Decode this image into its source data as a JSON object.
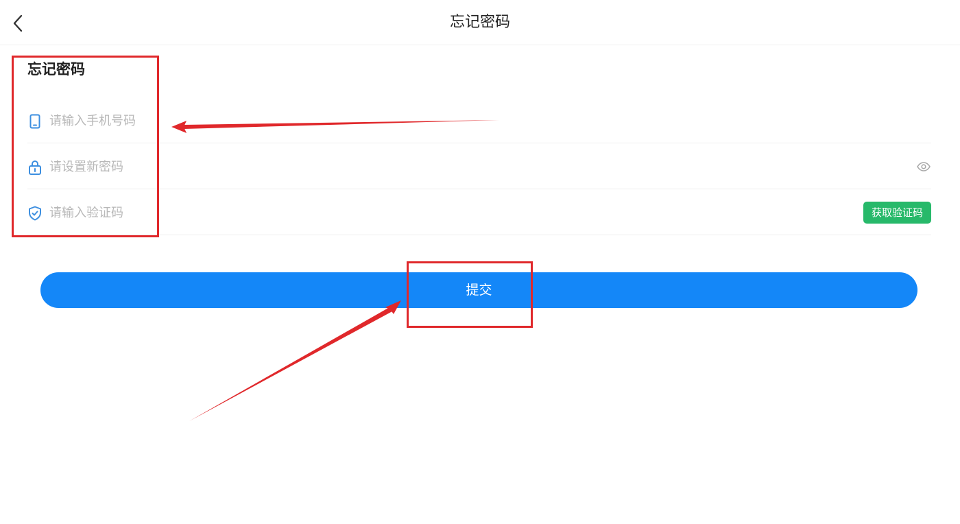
{
  "navbar": {
    "title": "忘记密码",
    "back_icon": "chevron-left-icon"
  },
  "form": {
    "heading": "忘记密码",
    "phone": {
      "icon": "phone-icon",
      "value": "",
      "placeholder": "请输入手机号码"
    },
    "password": {
      "icon": "lock-icon",
      "value": "",
      "placeholder": "请设置新密码",
      "toggle_icon": "eye-icon"
    },
    "code": {
      "icon": "shield-check-icon",
      "value": "",
      "placeholder": "请输入验证码",
      "get_code_label": "获取验证码"
    },
    "submit_label": "提交"
  },
  "colors": {
    "primary": "#1487f8",
    "success": "#27b96a",
    "icon_blue": "#3d8fe0",
    "annotation_red": "#e0282b"
  }
}
